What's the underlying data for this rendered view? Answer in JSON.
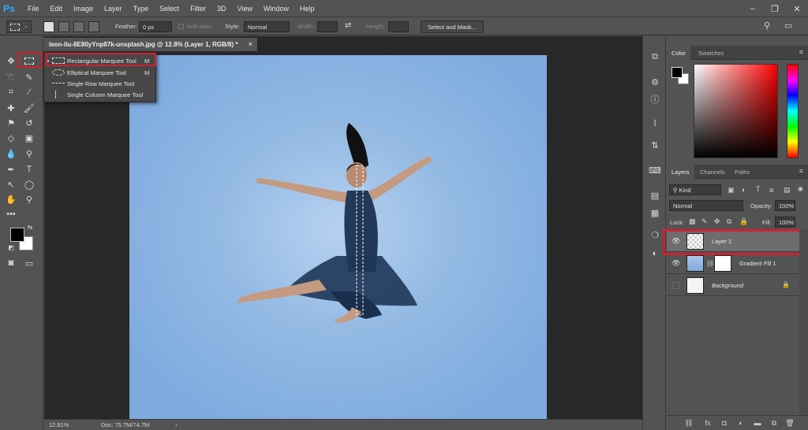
{
  "app": {
    "logo": "Ps",
    "menu": [
      "File",
      "Edit",
      "Image",
      "Layer",
      "Type",
      "Select",
      "Filter",
      "3D",
      "View",
      "Window",
      "Help"
    ],
    "window_controls": [
      "–",
      "❐",
      "✕"
    ]
  },
  "options_bar": {
    "feather_label": "Feather:",
    "feather_value": "0 px",
    "anti_alias_label": "Anti-alias",
    "style_label": "Style:",
    "style_value": "Normal",
    "width_label": "Width:",
    "height_label": "Height:",
    "swap_glyph": "⇄",
    "select_mask_label": "Select and Mask...",
    "search_glyph": "⚲",
    "workspace_glyph": "▭"
  },
  "document": {
    "tab_title": "leon-liu-8E80yYnp87k-unsplash.jpg @ 12.8% (Layer 1, RGB/8) *",
    "tab_close": "×",
    "zoom": "12.81%",
    "doc_size": "Doc: 75.7M/74.7M",
    "status_arrow": "›"
  },
  "tool_flyout": {
    "items": [
      {
        "label": "Rectangular Marquee Tool",
        "key": "M",
        "active": true
      },
      {
        "label": "Elliptical Marquee Tool",
        "key": "M",
        "active": false
      },
      {
        "label": "Single Row Marquee Tool",
        "key": "",
        "active": false
      },
      {
        "label": "Single Column Marquee Tool",
        "key": "",
        "active": false
      }
    ]
  },
  "color_panel": {
    "tabs": [
      "Color",
      "Swatches"
    ],
    "foreground": "#000000",
    "background": "#ffffff"
  },
  "layers_panel": {
    "tabs": [
      "Layers",
      "Channels",
      "Paths"
    ],
    "filter_label": "Kind",
    "blend_mode": "Normal",
    "opacity_label": "Opacity:",
    "opacity_value": "100%",
    "lock_label": "Lock:",
    "fill_label": "Fill:",
    "fill_value": "100%",
    "layers": [
      {
        "name": "Layer 1",
        "visible": true,
        "selected": true
      },
      {
        "name": "Gradient Fill 1",
        "visible": true,
        "selected": false
      },
      {
        "name": "Background",
        "visible": false,
        "selected": false,
        "locked": true
      }
    ]
  },
  "colors": {
    "accent_highlight": "#d02030",
    "panel_bg": "#535353",
    "canvas_bg": "#8cb5e2"
  }
}
